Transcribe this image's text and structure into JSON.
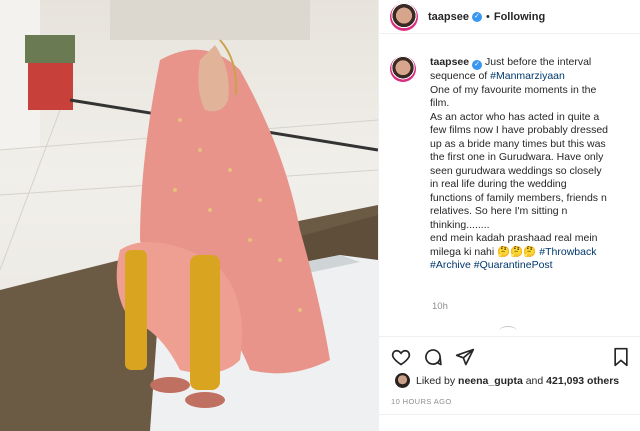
{
  "header": {
    "username": "taapsee",
    "separator": "•",
    "follow_status": "Following"
  },
  "caption": {
    "username": "taapsee",
    "lines": [
      "Just before the interval",
      "sequence of"
    ],
    "hashtag_1": "#Manmarziyaan",
    "body": [
      "One of my favourite moments in the",
      "film.",
      "As an actor who has acted in quite a",
      "few films now I have probably dressed",
      "up as a bride many times but this was",
      "the first one in Gurudwara. Have only",
      "seen gurudwara weddings so closely",
      "in real life during the wedding",
      "functions of family members, friends n",
      "relatives. So here I'm sitting n",
      "thinking........",
      "end mein kadah prashaad real mein",
      "milega ki nahi 🤔🤔🤔"
    ],
    "hashtag_2": "#Throwback",
    "hashtag_3": "#Archive",
    "hashtag_4": "#QuarantinePost",
    "time": "10h"
  },
  "likes": {
    "prefix": "Liked by",
    "user": "neena_gupta",
    "middle": "and",
    "count": "421,093 others"
  },
  "posted": "10 HOURS AGO",
  "icons": [
    "heart-icon",
    "comment-icon",
    "share-icon",
    "bookmark-icon",
    "verified-badge-icon"
  ],
  "colors": {
    "accent": "#3897f0",
    "hashtag": "#00376b",
    "meta": "#8e8e8e",
    "dress": "#e8948a",
    "gold": "#d9a521"
  }
}
